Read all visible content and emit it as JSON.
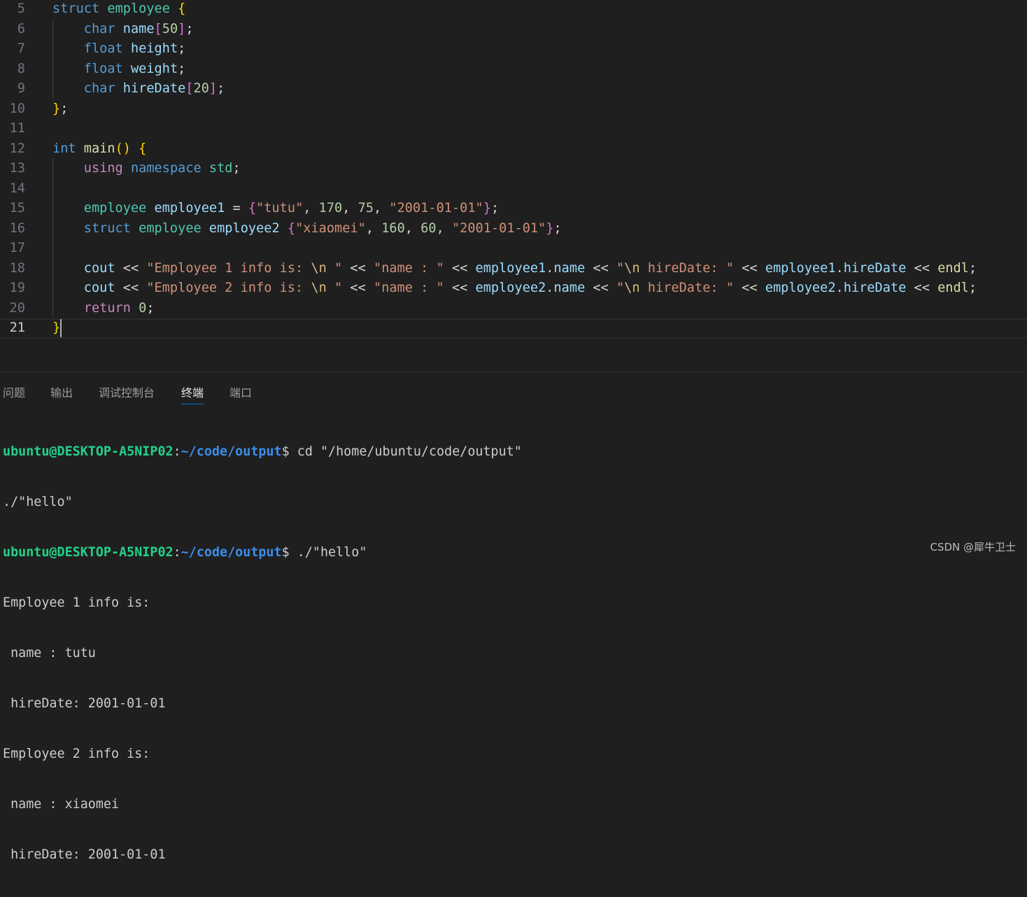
{
  "editor": {
    "lines": [
      {
        "num": "5",
        "tokens": [
          {
            "c": "kw",
            "t": "struct"
          },
          {
            "c": "pun",
            "t": " "
          },
          {
            "c": "ty",
            "t": "employee"
          },
          {
            "c": "pun",
            "t": " "
          },
          {
            "c": "br1",
            "t": "{"
          }
        ]
      },
      {
        "num": "6",
        "tokens": [
          {
            "c": "pun",
            "t": "    "
          },
          {
            "c": "kw",
            "t": "char"
          },
          {
            "c": "pun",
            "t": " "
          },
          {
            "c": "var",
            "t": "name"
          },
          {
            "c": "br2",
            "t": "["
          },
          {
            "c": "num",
            "t": "50"
          },
          {
            "c": "br2",
            "t": "]"
          },
          {
            "c": "pun",
            "t": ";"
          }
        ]
      },
      {
        "num": "7",
        "tokens": [
          {
            "c": "pun",
            "t": "    "
          },
          {
            "c": "kw",
            "t": "float"
          },
          {
            "c": "pun",
            "t": " "
          },
          {
            "c": "var",
            "t": "height"
          },
          {
            "c": "pun",
            "t": ";"
          }
        ]
      },
      {
        "num": "8",
        "tokens": [
          {
            "c": "pun",
            "t": "    "
          },
          {
            "c": "kw",
            "t": "float"
          },
          {
            "c": "pun",
            "t": " "
          },
          {
            "c": "var",
            "t": "weight"
          },
          {
            "c": "pun",
            "t": ";"
          }
        ]
      },
      {
        "num": "9",
        "tokens": [
          {
            "c": "pun",
            "t": "    "
          },
          {
            "c": "kw",
            "t": "char"
          },
          {
            "c": "pun",
            "t": " "
          },
          {
            "c": "var",
            "t": "hireDate"
          },
          {
            "c": "br2",
            "t": "["
          },
          {
            "c": "num",
            "t": "20"
          },
          {
            "c": "br2",
            "t": "]"
          },
          {
            "c": "pun",
            "t": ";"
          }
        ]
      },
      {
        "num": "10",
        "tokens": [
          {
            "c": "br1",
            "t": "}"
          },
          {
            "c": "pun",
            "t": ";"
          }
        ]
      },
      {
        "num": "11",
        "tokens": []
      },
      {
        "num": "12",
        "tokens": [
          {
            "c": "kw",
            "t": "int"
          },
          {
            "c": "pun",
            "t": " "
          },
          {
            "c": "fn",
            "t": "main"
          },
          {
            "c": "br1",
            "t": "()"
          },
          {
            "c": "pun",
            "t": " "
          },
          {
            "c": "br1",
            "t": "{"
          }
        ]
      },
      {
        "num": "13",
        "tokens": [
          {
            "c": "pun",
            "t": "    "
          },
          {
            "c": "ctl",
            "t": "using"
          },
          {
            "c": "pun",
            "t": " "
          },
          {
            "c": "kw",
            "t": "namespace"
          },
          {
            "c": "pun",
            "t": " "
          },
          {
            "c": "ty",
            "t": "std"
          },
          {
            "c": "pun",
            "t": ";"
          }
        ]
      },
      {
        "num": "14",
        "tokens": []
      },
      {
        "num": "15",
        "tokens": [
          {
            "c": "pun",
            "t": "    "
          },
          {
            "c": "ty",
            "t": "employee"
          },
          {
            "c": "pun",
            "t": " "
          },
          {
            "c": "var",
            "t": "employee1"
          },
          {
            "c": "pun",
            "t": " = "
          },
          {
            "c": "br2",
            "t": "{"
          },
          {
            "c": "str",
            "t": "\"tutu\""
          },
          {
            "c": "pun",
            "t": ", "
          },
          {
            "c": "num",
            "t": "170"
          },
          {
            "c": "pun",
            "t": ", "
          },
          {
            "c": "num",
            "t": "75"
          },
          {
            "c": "pun",
            "t": ", "
          },
          {
            "c": "str",
            "t": "\"2001-01-01\""
          },
          {
            "c": "br2",
            "t": "}"
          },
          {
            "c": "pun",
            "t": ";"
          }
        ]
      },
      {
        "num": "16",
        "tokens": [
          {
            "c": "pun",
            "t": "    "
          },
          {
            "c": "kw",
            "t": "struct"
          },
          {
            "c": "pun",
            "t": " "
          },
          {
            "c": "ty",
            "t": "employee"
          },
          {
            "c": "pun",
            "t": " "
          },
          {
            "c": "var",
            "t": "employee2"
          },
          {
            "c": "pun",
            "t": " "
          },
          {
            "c": "br2",
            "t": "{"
          },
          {
            "c": "str",
            "t": "\"xiaomei\""
          },
          {
            "c": "pun",
            "t": ", "
          },
          {
            "c": "num",
            "t": "160"
          },
          {
            "c": "pun",
            "t": ", "
          },
          {
            "c": "num",
            "t": "60"
          },
          {
            "c": "pun",
            "t": ", "
          },
          {
            "c": "str",
            "t": "\"2001-01-01\""
          },
          {
            "c": "br2",
            "t": "}"
          },
          {
            "c": "pun",
            "t": ";"
          }
        ]
      },
      {
        "num": "17",
        "tokens": []
      },
      {
        "num": "18",
        "tokens": [
          {
            "c": "pun",
            "t": "    "
          },
          {
            "c": "var",
            "t": "cout"
          },
          {
            "c": "pun",
            "t": " << "
          },
          {
            "c": "str",
            "t": "\"Employee 1 info is: "
          },
          {
            "c": "esc",
            "t": "\\n"
          },
          {
            "c": "str",
            "t": " \""
          },
          {
            "c": "pun",
            "t": " << "
          },
          {
            "c": "str",
            "t": "\"name : \""
          },
          {
            "c": "pun",
            "t": " << "
          },
          {
            "c": "var",
            "t": "employee1"
          },
          {
            "c": "pun",
            "t": "."
          },
          {
            "c": "var",
            "t": "name"
          },
          {
            "c": "pun",
            "t": " << "
          },
          {
            "c": "str",
            "t": "\""
          },
          {
            "c": "esc",
            "t": "\\n"
          },
          {
            "c": "str",
            "t": " hireDate: \""
          },
          {
            "c": "pun",
            "t": " << "
          },
          {
            "c": "var",
            "t": "employee1"
          },
          {
            "c": "pun",
            "t": "."
          },
          {
            "c": "var",
            "t": "hireDate"
          },
          {
            "c": "pun",
            "t": " << "
          },
          {
            "c": "fn",
            "t": "endl"
          },
          {
            "c": "pun",
            "t": ";"
          }
        ]
      },
      {
        "num": "19",
        "tokens": [
          {
            "c": "pun",
            "t": "    "
          },
          {
            "c": "var",
            "t": "cout"
          },
          {
            "c": "pun",
            "t": " << "
          },
          {
            "c": "str",
            "t": "\"Employee 2 info is: "
          },
          {
            "c": "esc",
            "t": "\\n"
          },
          {
            "c": "str",
            "t": " \""
          },
          {
            "c": "pun",
            "t": " << "
          },
          {
            "c": "str",
            "t": "\"name : \""
          },
          {
            "c": "pun",
            "t": " << "
          },
          {
            "c": "var",
            "t": "employee2"
          },
          {
            "c": "pun",
            "t": "."
          },
          {
            "c": "var",
            "t": "name"
          },
          {
            "c": "pun",
            "t": " << "
          },
          {
            "c": "str",
            "t": "\""
          },
          {
            "c": "esc",
            "t": "\\n"
          },
          {
            "c": "str",
            "t": " hireDate: \""
          },
          {
            "c": "pun",
            "t": " << "
          },
          {
            "c": "var",
            "t": "employee2"
          },
          {
            "c": "pun",
            "t": "."
          },
          {
            "c": "var",
            "t": "hireDate"
          },
          {
            "c": "pun",
            "t": " << "
          },
          {
            "c": "fn",
            "t": "endl"
          },
          {
            "c": "pun",
            "t": ";"
          }
        ]
      },
      {
        "num": "20",
        "tokens": [
          {
            "c": "pun",
            "t": "    "
          },
          {
            "c": "ctl",
            "t": "return"
          },
          {
            "c": "pun",
            "t": " "
          },
          {
            "c": "num",
            "t": "0"
          },
          {
            "c": "pun",
            "t": ";"
          }
        ]
      },
      {
        "num": "21",
        "tokens": [
          {
            "c": "br1",
            "t": "}"
          }
        ],
        "current": true
      }
    ]
  },
  "panel": {
    "tabs": [
      {
        "label": "问题",
        "active": false
      },
      {
        "label": "输出",
        "active": false
      },
      {
        "label": "调试控制台",
        "active": false
      },
      {
        "label": "终端",
        "active": true
      },
      {
        "label": "端口",
        "active": false
      }
    ]
  },
  "terminal": {
    "lines": [
      {
        "user": "ubuntu@DESKTOP-A5NIP02",
        "sep": ":",
        "path": "~/code/output",
        "rest": "$ cd \"/home/ubuntu/code/output\""
      },
      {
        "text": "./\"hello\""
      },
      {
        "user": "ubuntu@DESKTOP-A5NIP02",
        "sep": ":",
        "path": "~/code/output",
        "rest": "$ ./\"hello\""
      },
      {
        "text": "Employee 1 info is:"
      },
      {
        "text": " name : tutu"
      },
      {
        "text": " hireDate: 2001-01-01"
      },
      {
        "text": "Employee 2 info is:"
      },
      {
        "text": " name : xiaomei"
      },
      {
        "text": " hireDate: 2001-01-01"
      }
    ]
  },
  "watermark": "CSDN @犀牛卫士"
}
